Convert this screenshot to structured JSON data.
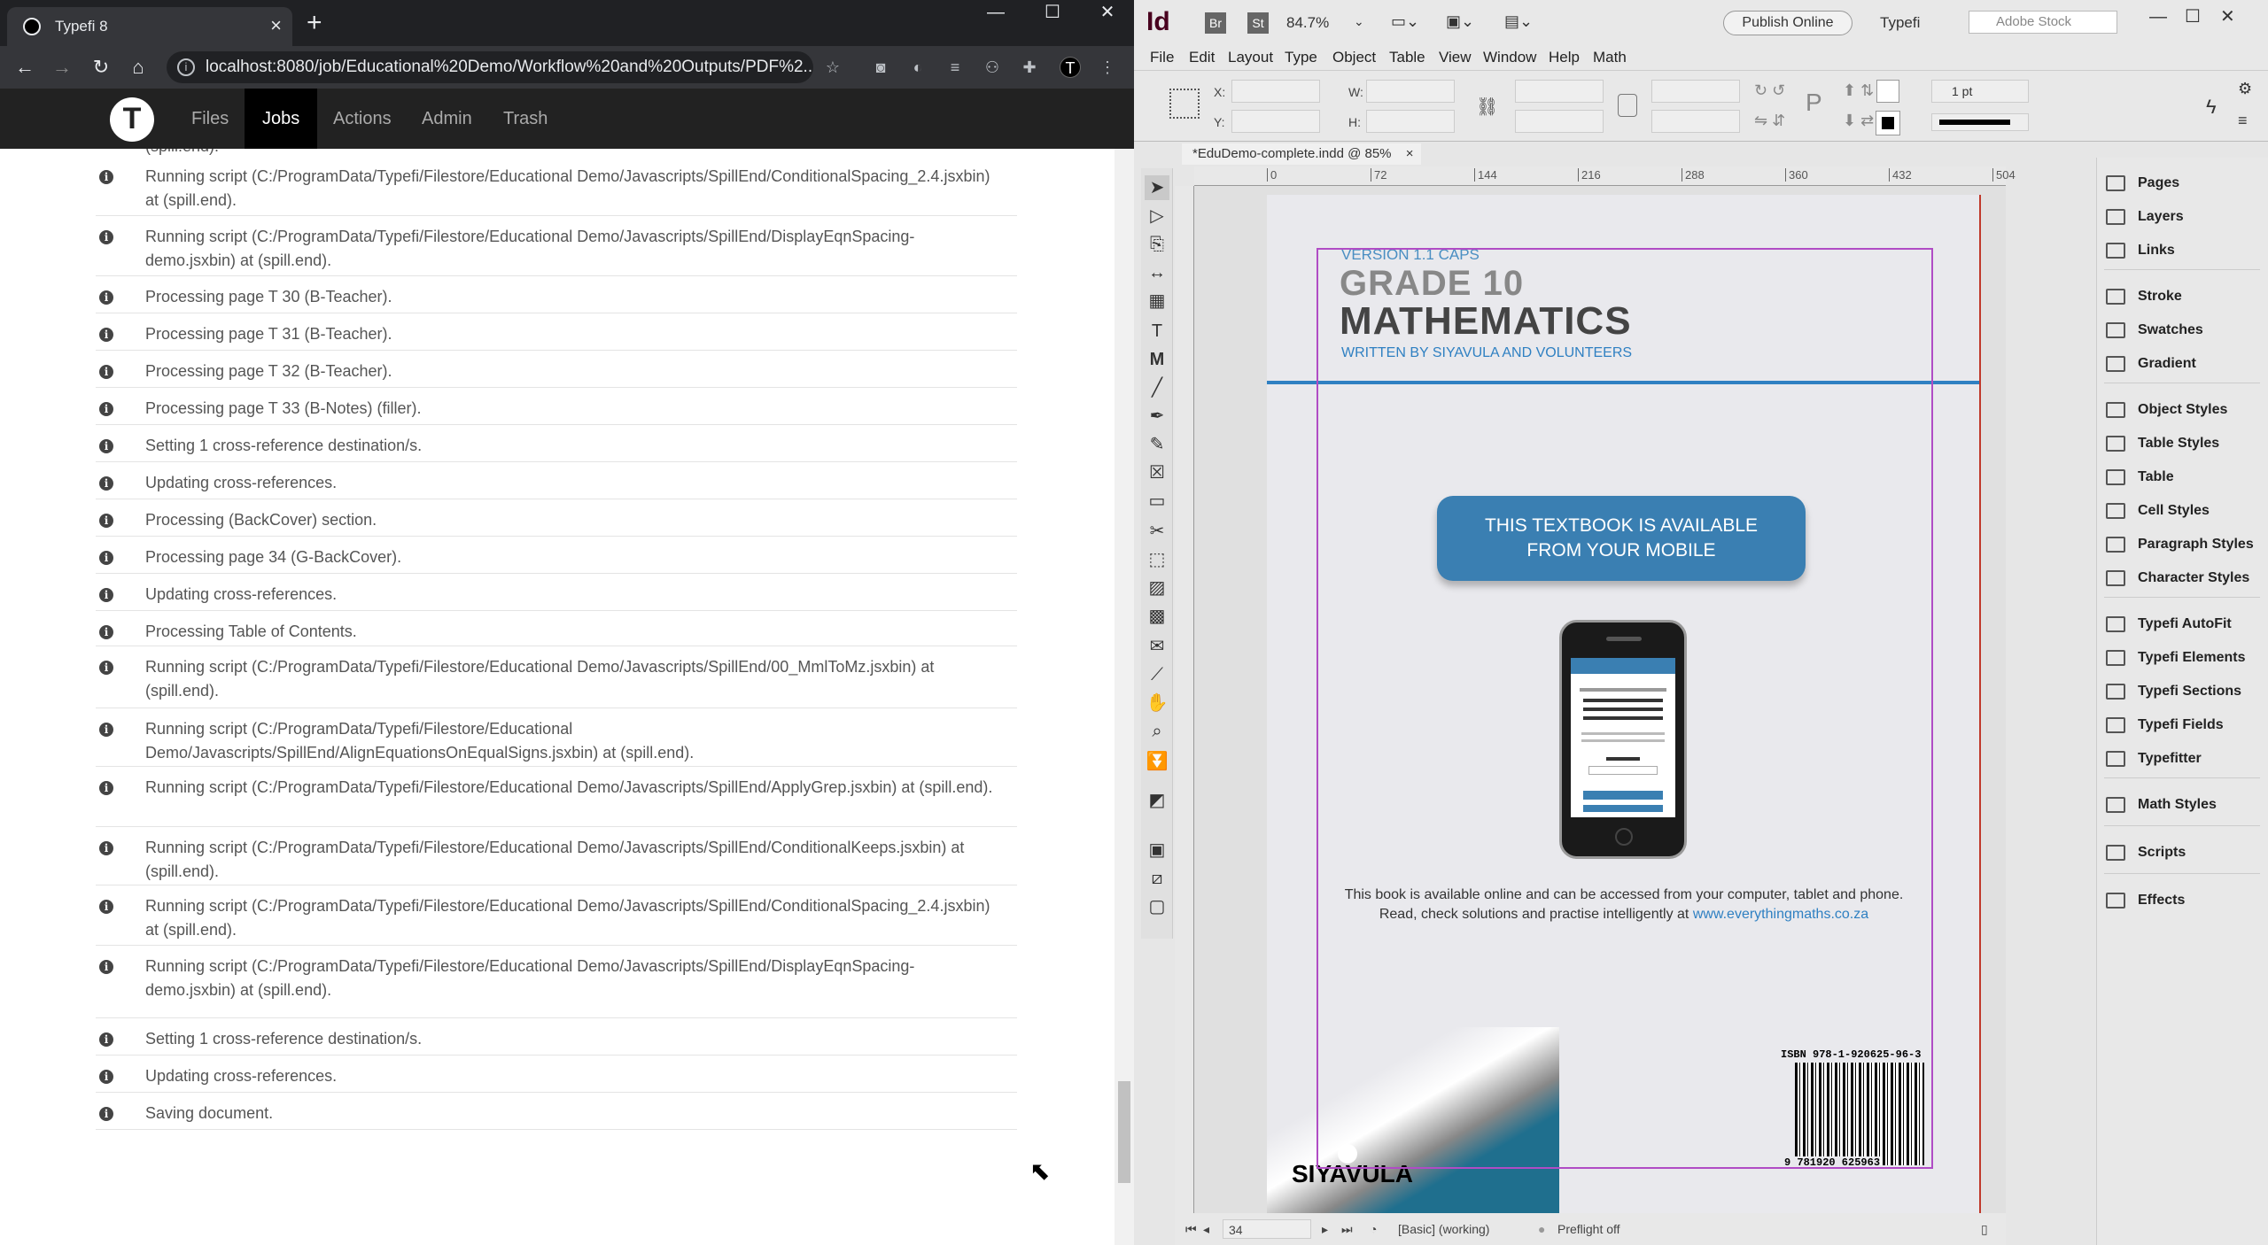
{
  "browser": {
    "tab_title": "Typefi 8",
    "tab_close": "×",
    "new_tab": "+",
    "url": "localhost:8080/job/Educational%20Demo/Workflow%20and%20Outputs/PDF%2...",
    "win_min": "—",
    "win_max": "☐",
    "win_close": "✕"
  },
  "app": {
    "logo": "T",
    "nav": [
      {
        "label": "Files",
        "active": false
      },
      {
        "label": "Jobs",
        "active": true
      },
      {
        "label": "Actions",
        "active": false
      },
      {
        "label": "Admin",
        "active": false
      },
      {
        "label": "Trash",
        "active": false
      }
    ]
  },
  "log": {
    "partial_first": "(spill.end).",
    "entries": [
      "Running script (C:/ProgramData/Typefi/Filestore/Educational Demo/Javascripts/SpillEnd/ConditionalSpacing_2.4.jsxbin) at (spill.end).",
      "Running script (C:/ProgramData/Typefi/Filestore/Educational Demo/Javascripts/SpillEnd/DisplayEqnSpacing-demo.jsxbin) at (spill.end).",
      "Processing page T 30 (B-Teacher).",
      "Processing page T 31 (B-Teacher).",
      "Processing page T 32 (B-Teacher).",
      "Processing page T 33 (B-Notes) (filler).",
      "Setting 1 cross-reference destination/s.",
      "Updating cross-references.",
      "Processing (BackCover) section.",
      "Processing page 34 (G-BackCover).",
      "Updating cross-references.",
      "Processing Table of Contents.",
      "Running script (C:/ProgramData/Typefi/Filestore/Educational Demo/Javascripts/SpillEnd/00_MmlToMz.jsxbin) at (spill.end).",
      "Running script (C:/ProgramData/Typefi/Filestore/Educational Demo/Javascripts/SpillEnd/AlignEquationsOnEqualSigns.jsxbin) at (spill.end).",
      "Running script (C:/ProgramData/Typefi/Filestore/Educational Demo/Javascripts/SpillEnd/ApplyGrep.jsxbin) at (spill.end).",
      "Running script (C:/ProgramData/Typefi/Filestore/Educational Demo/Javascripts/SpillEnd/ConditionalKeeps.jsxbin) at (spill.end).",
      "Running script (C:/ProgramData/Typefi/Filestore/Educational Demo/Javascripts/SpillEnd/ConditionalSpacing_2.4.jsxbin) at (spill.end).",
      "Running script (C:/ProgramData/Typefi/Filestore/Educational Demo/Javascripts/SpillEnd/DisplayEqnSpacing-demo.jsxbin) at (spill.end).",
      "Setting 1 cross-reference destination/s.",
      "Updating cross-references.",
      "Saving document."
    ],
    "info_icon": "i"
  },
  "indesign": {
    "logo": "Id",
    "br": "Br",
    "st": "St",
    "zoom": "84.7%",
    "publish": "Publish Online",
    "workspace": "Typefi",
    "stock_placeholder": "Adobe Stock",
    "menus": [
      "File",
      "Edit",
      "Layout",
      "Type",
      "Object",
      "Table",
      "View",
      "Window",
      "Help",
      "Math"
    ],
    "ctrl": {
      "x": "X:",
      "y": "Y:",
      "w": "W:",
      "h": "H:",
      "stroke": "1 pt"
    },
    "doc_tab": "*EduDemo-complete.indd @ 85%",
    "doc_tab_close": "×",
    "ruler": [
      "0",
      "72",
      "144",
      "216",
      "288",
      "360",
      "432",
      "504"
    ],
    "status": {
      "page": "34",
      "style": "[Basic] (working)",
      "preflight": "Preflight off"
    },
    "panels": [
      "Pages",
      "Layers",
      "Links",
      "Stroke",
      "Swatches",
      "Gradient",
      "Object Styles",
      "Table Styles",
      "Table",
      "Cell Styles",
      "Paragraph Styles",
      "Character Styles",
      "Typefi AutoFit",
      "Typefi Elements",
      "Typefi Sections",
      "Typefi Fields",
      "Typefitter",
      "Math Styles",
      "Scripts",
      "Effects"
    ]
  },
  "cover": {
    "version": "VERSION 1.1 CAPS",
    "grade": "GRADE 10",
    "subject": "MATHEMATICS",
    "written": "WRITTEN BY SIYAVULA AND VOLUNTEERS",
    "mobile_line1": "THIS TEXTBOOK IS AVAILABLE",
    "mobile_line2": "FROM YOUR MOBILE",
    "avail_line1": "This book is available online and can be accessed from your computer, tablet and phone.",
    "avail_line2": "Read, check solutions and practise intelligently at ",
    "avail_link": "www.everythingmaths.co.za",
    "publisher": "SIYAVULA",
    "isbn_top": "ISBN 978-1-920625-96-3",
    "isbn_bottom": "9 781920 625963"
  }
}
